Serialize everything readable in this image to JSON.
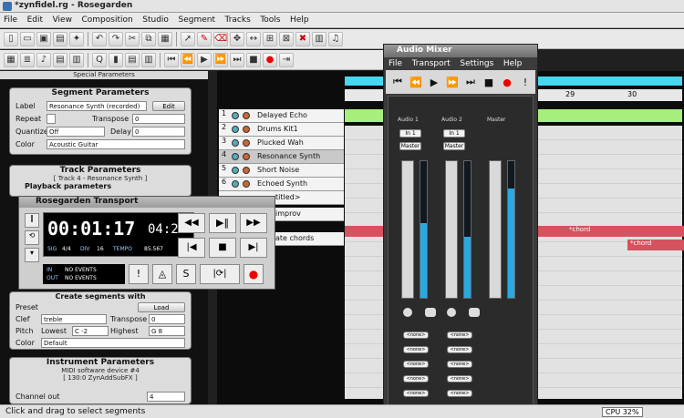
{
  "window": {
    "title": "*zynfidel.rg - Rosegarden"
  },
  "menu": [
    "File",
    "Edit",
    "View",
    "Composition",
    "Studio",
    "Segment",
    "Tracks",
    "Tools",
    "Help"
  ],
  "special_params_title": "Special Parameters",
  "segment_params": {
    "title": "Segment Parameters",
    "label_caption": "Label",
    "label_value": "Resonance Synth (recorded)",
    "edit_button": "Edit",
    "repeat_caption": "Repeat",
    "transpose_caption": "Transpose",
    "transpose_value": "0",
    "quantize_caption": "Quantize",
    "quantize_value": "Off",
    "delay_caption": "Delay",
    "delay_value": "0",
    "color_caption": "Color",
    "color_value": "Acoustic Guitar"
  },
  "track_params": {
    "title": "Track Parameters",
    "subtitle": "[ Track 4 - Resonance Synth ]",
    "playback_title": "Playback parameters"
  },
  "create_segments": {
    "title": "Create segments with",
    "preset_caption": "Preset",
    "load_button": "Load",
    "clef_caption": "Clef",
    "clef_value": "treble",
    "transpose_caption": "Transpose",
    "transpose_value": "0",
    "pitch_caption": "Pitch",
    "lowest_caption": "Lowest",
    "lowest_value": "C -2",
    "highest_caption": "Highest",
    "highest_value": "G 8",
    "color_caption": "Color",
    "color_value": "Default"
  },
  "instrument_params": {
    "title": "Instrument Parameters",
    "device": "MIDI software device #4",
    "port": "[ 130:0 ZynAddSubFX ]",
    "channel_caption": "Channel out",
    "channel_value": "4"
  },
  "tracks": [
    {
      "num": "1",
      "name": "Delayed Echo"
    },
    {
      "num": "2",
      "name": "Drums Kit1"
    },
    {
      "num": "3",
      "name": "Plucked Wah"
    },
    {
      "num": "4",
      "name": "Resonance Synth"
    },
    {
      "num": "5",
      "name": "Short Noise"
    },
    {
      "num": "6",
      "name": "Echoed Synth"
    },
    {
      "num": "7",
      "name": "titled>"
    },
    {
      "num": "8",
      "name": "improv"
    },
    {
      "num": "9",
      "name": "ate chords"
    }
  ],
  "ruler": {
    "bar_29": "29",
    "bar_30": "30"
  },
  "segments": {
    "chord_a": "*chord",
    "chord_b": "*chord"
  },
  "transport": {
    "title": "Rosegarden Transport",
    "time": "00:01:17:04:22",
    "time_main": "00:01:17",
    "time_sub": "04:22",
    "sig_caption": "SIG",
    "sig_value": "4/4",
    "div_caption": "DIV",
    "div_value": "16",
    "tempo_caption": "TEMPO",
    "tempo_value": "85.567",
    "in_caption": "IN",
    "in_value": "NO EVENTS",
    "out_caption": "OUT",
    "out_value": "NO EVENTS"
  },
  "mixer": {
    "title": "Audio Mixer",
    "menu": [
      "File",
      "Transport",
      "Settings",
      "Help"
    ],
    "strip1": "Audio 1",
    "strip2": "Audio 2",
    "master": "Master",
    "in_label": "In 1",
    "master_label": "Master",
    "plugin_label": "<none>",
    "meter_level_1": 0.55,
    "meter_level_2": 0.45,
    "meter_level_master": 0.8
  },
  "status": {
    "message": "Click and drag to select segments",
    "cpu": "CPU 32%"
  },
  "colors": {
    "accent_cyan": "#48d6f0",
    "segment_green": "#a6ef7c",
    "segment_red": "#d7525f",
    "selected_track": "#c9c9c9"
  }
}
